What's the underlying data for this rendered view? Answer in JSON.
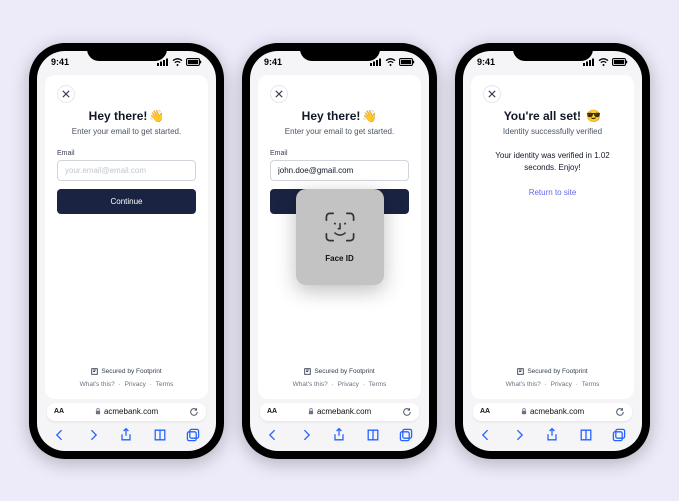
{
  "status": {
    "time": "9:41"
  },
  "browser": {
    "site": "acmebank.com",
    "aA": "AA"
  },
  "footer": {
    "secured": "Secured by Footprint",
    "whats": "What's this?",
    "privacy": "Privacy",
    "terms": "Terms",
    "sep": "·"
  },
  "screens": {
    "s1": {
      "title": "Hey there!",
      "emoji": "👋",
      "sub": "Enter your email to get started.",
      "label": "Email",
      "placeholder": "your.email@email.com",
      "btn": "Continue"
    },
    "s2": {
      "title": "Hey there!",
      "emoji": "👋",
      "sub": "Enter your email to get started.",
      "label": "Email",
      "val": "john.doe@gmail.com",
      "faceid": "Face ID"
    },
    "s3": {
      "title": "You're all set!",
      "emoji": "😎",
      "sub": "Identity successfully verified",
      "msg": "Your identity was verified in 1.02 seconds. Enjoy!",
      "link": "Return to site"
    }
  }
}
